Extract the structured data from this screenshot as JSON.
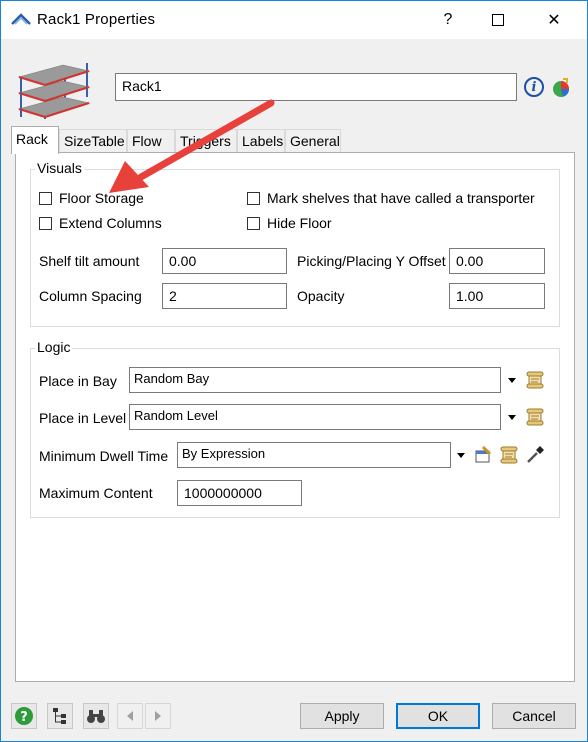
{
  "window": {
    "title": "Rack1  Properties",
    "help_glyph": "?",
    "close_glyph": "✕"
  },
  "header": {
    "name_value": "Rack1",
    "info_glyph": "i"
  },
  "tabs": [
    {
      "label": "Rack",
      "active": true
    },
    {
      "label": "SizeTable"
    },
    {
      "label": "Flow"
    },
    {
      "label": "Triggers"
    },
    {
      "label": "Labels"
    },
    {
      "label": "General"
    }
  ],
  "visuals": {
    "legend": "Visuals",
    "floor_storage": "Floor Storage",
    "extend_columns": "Extend Columns",
    "mark_shelves": "Mark shelves that have called a transporter",
    "hide_floor": "Hide Floor",
    "shelf_tilt_label": "Shelf tilt amount",
    "shelf_tilt_value": "0.00",
    "picking_offset_label": "Picking/Placing Y Offset",
    "picking_offset_value": "0.00",
    "column_spacing_label": "Column Spacing",
    "column_spacing_value": "2",
    "opacity_label": "Opacity",
    "opacity_value": "1.00"
  },
  "logic": {
    "legend": "Logic",
    "place_in_bay_label": "Place in Bay",
    "place_in_bay_value": "Random Bay",
    "place_in_level_label": "Place in Level",
    "place_in_level_value": "Random Level",
    "min_dwell_label": "Minimum Dwell Time",
    "min_dwell_value": "By Expression",
    "max_content_label": "Maximum Content",
    "max_content_value": "1000000000"
  },
  "footer": {
    "apply": "Apply",
    "ok": "OK",
    "cancel": "Cancel"
  },
  "colors": {
    "accent": "#0078d7",
    "annotation_arrow": "#e8403a"
  }
}
